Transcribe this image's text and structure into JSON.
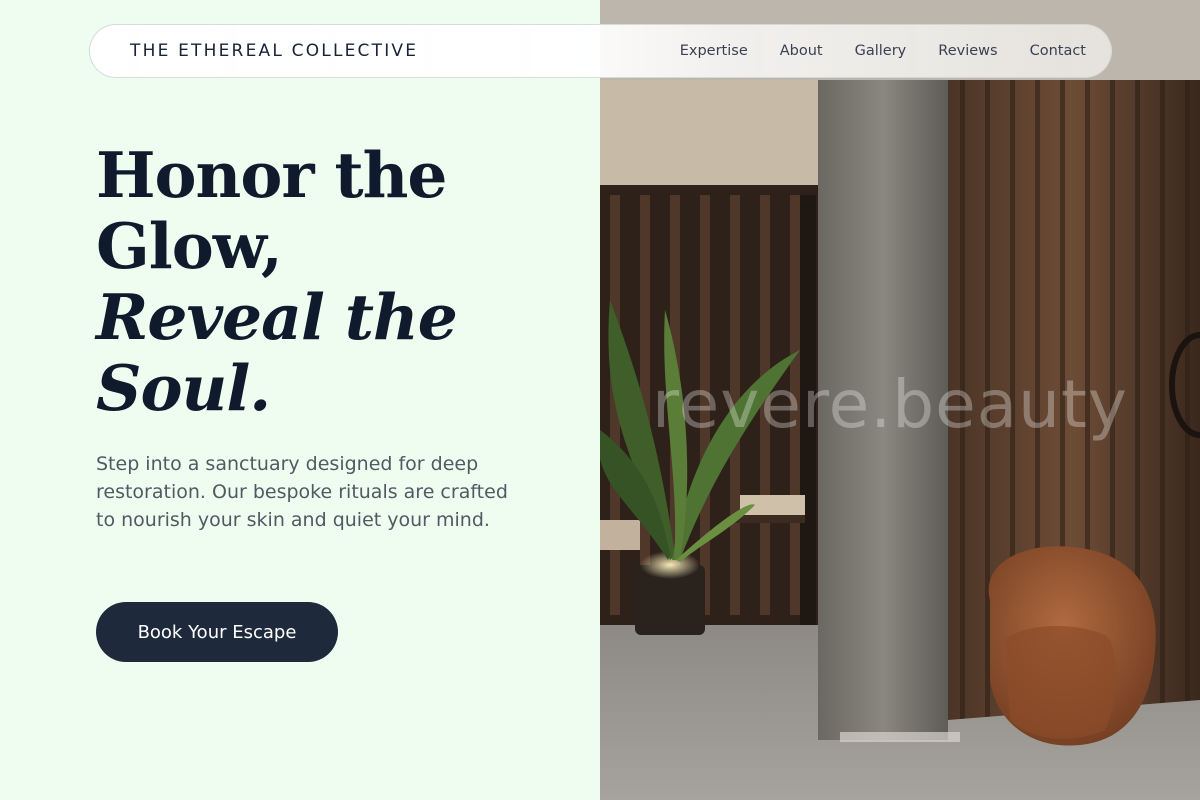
{
  "brand": {
    "name": "THE ETHEREAL COLLECTIVE"
  },
  "nav": {
    "items": [
      {
        "label": "Expertise"
      },
      {
        "label": "About"
      },
      {
        "label": "Gallery"
      },
      {
        "label": "Reviews"
      },
      {
        "label": "Contact"
      }
    ]
  },
  "hero": {
    "headline_line1": "Honor the Glow,",
    "headline_line2": "Reveal the Soul.",
    "subtitle": "Step into a sanctuary designed for deep restoration. Our bespoke rituals are crafted to nourish your skin and quiet your mind.",
    "cta_label": "Book Your Escape"
  },
  "photo": {
    "watermark": "revere.beauty",
    "description_icon": "spa-interior-photo"
  },
  "colors": {
    "background": "#effdf1",
    "heading": "#0f1b2d",
    "body_text": "#4f5a63",
    "cta_background": "#1e2a3c",
    "cta_text": "#ffffff"
  }
}
